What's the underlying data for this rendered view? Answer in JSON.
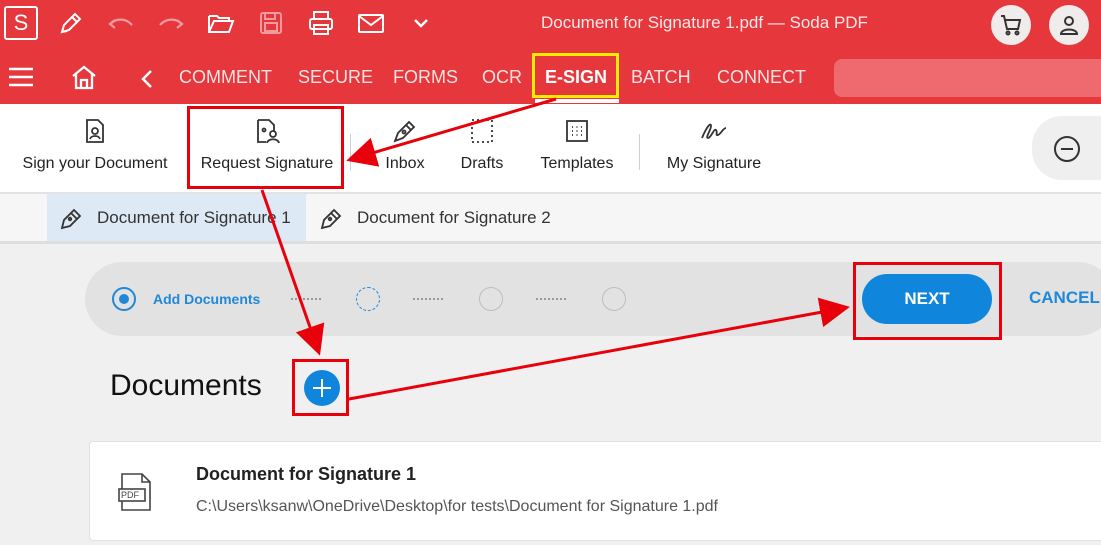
{
  "app": {
    "logo_letter": "S",
    "document_title": "Document for Signature 1.pdf  —  Soda PDF"
  },
  "quick_icons": [
    "edit-pen-icon",
    "undo-icon",
    "redo-icon",
    "open-folder-icon",
    "save-icon",
    "print-icon",
    "mail-icon",
    "chevron-down-icon"
  ],
  "ribbon": {
    "tabs": [
      {
        "label": "COMMENT",
        "active": false
      },
      {
        "label": "SECURE",
        "active": false
      },
      {
        "label": "FORMS",
        "active": false
      },
      {
        "label": "OCR",
        "active": false
      },
      {
        "label": "E-SIGN",
        "active": true
      },
      {
        "label": "BATCH",
        "active": false
      },
      {
        "label": "CONNECT",
        "active": false
      }
    ]
  },
  "toolbar": {
    "sign_document": "Sign your Document",
    "request_signature": "Request Signature",
    "inbox": "Inbox",
    "drafts": "Drafts",
    "templates": "Templates",
    "my_signature": "My Signature"
  },
  "doc_tabs": [
    {
      "label": "Document for Signature 1",
      "active": true
    },
    {
      "label": "Document for Signature 2",
      "active": false
    }
  ],
  "stepper": {
    "step1_label": "Add Documents",
    "next": "NEXT",
    "cancel": "CANCEL"
  },
  "documents": {
    "heading": "Documents",
    "items": [
      {
        "name": "Document for Signature 1",
        "path": "C:\\Users\\ksanw\\OneDrive\\Desktop\\for tests\\Document for Signature 1.pdf",
        "icon_text": "PDF"
      }
    ]
  },
  "colors": {
    "brand_red": "#e6373d",
    "accent_blue": "#0f86db",
    "annotation_red": "#e8000b",
    "annotation_yellow": "#ffea00"
  }
}
